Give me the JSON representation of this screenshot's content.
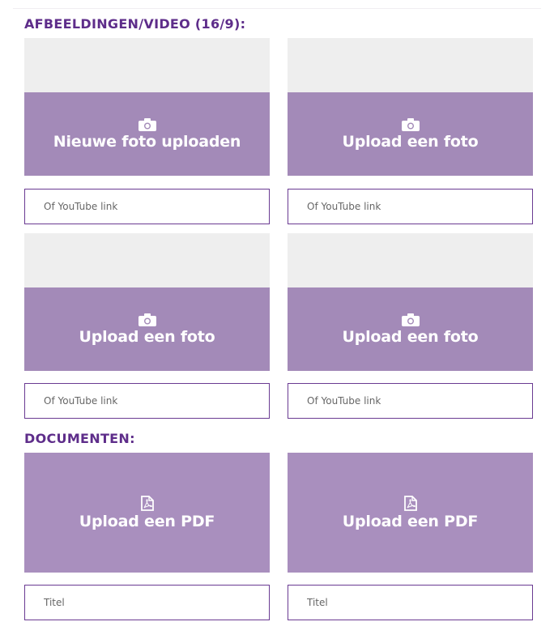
{
  "images_section": {
    "title": "AFBEELDINGEN/VIDEO (16/9):",
    "slots": [
      {
        "label": "Nieuwe foto uploaden",
        "icon": "camera-icon",
        "youtube_placeholder": "Of YouTube link"
      },
      {
        "label": "Upload een foto",
        "icon": "camera-icon",
        "youtube_placeholder": "Of YouTube link"
      },
      {
        "label": "Upload een foto",
        "icon": "camera-icon",
        "youtube_placeholder": "Of YouTube link"
      },
      {
        "label": "Upload een foto",
        "icon": "camera-icon",
        "youtube_placeholder": "Of YouTube link"
      }
    ]
  },
  "documents_section": {
    "title": "DOCUMENTEN:",
    "slots": [
      {
        "label": "Upload een PDF",
        "icon": "pdf-file-icon",
        "title_placeholder": "Titel"
      },
      {
        "label": "Upload een PDF",
        "icon": "pdf-file-icon",
        "title_placeholder": "Titel"
      }
    ]
  },
  "colors": {
    "accent": "#5e2d8a",
    "upload_band": "#a38ab8",
    "preview_bg": "#eeeeee",
    "field_border": "#6a3a92"
  }
}
